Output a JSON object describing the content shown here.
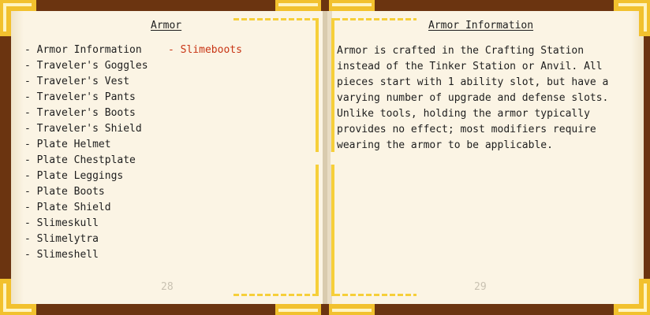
{
  "book": {
    "left_page": {
      "title": "Armor",
      "toc_column1": [
        "Armor Information",
        "Traveler's Goggles",
        "Traveler's Vest",
        "Traveler's Pants",
        "Traveler's Boots",
        "Traveler's Shield",
        "Plate Helmet",
        "Plate Chestplate",
        "Plate Leggings",
        "Plate Boots",
        "Plate Shield",
        "Slimeskull",
        "Slimelytra",
        "Slimeshell"
      ],
      "toc_column2": [
        "Slimeboots"
      ],
      "toc_bullet": "-",
      "page_number": "28"
    },
    "right_page": {
      "title": "Armor Information",
      "text": "Armor is crafted in the Crafting Station instead of the Tinker Station or Anvil. All pieces start with 1 ability slot, but have a varying number of upgrade and defense slots. Unlike tools, holding the armor typically provides no effect; most modifiers require wearing the armor to be applicable.",
      "page_number": "29"
    }
  },
  "colors": {
    "cover": "#6b3410",
    "paper": "#fbf4e4",
    "gold": "#f2c12e",
    "link_hover": "#c83414"
  }
}
